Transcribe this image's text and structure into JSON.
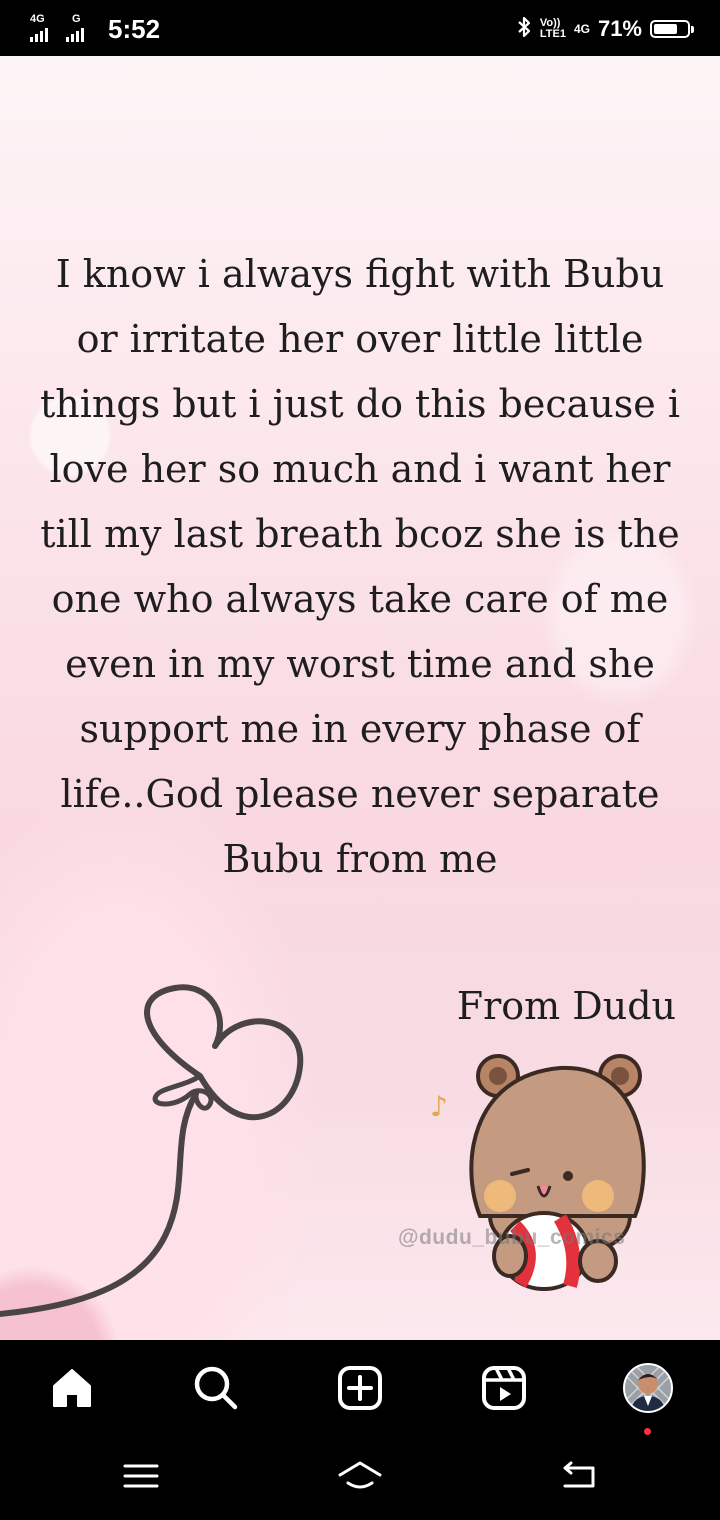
{
  "status_bar": {
    "sim1_network": "4G",
    "sim2_network": "G",
    "time": "5:52",
    "volte_line1": "Vo))",
    "volte_line2": "LTE1",
    "data_network": "4G",
    "battery_percent": "71%",
    "battery_level": 0.71,
    "icons": [
      "signal-icon",
      "signal-icon",
      "bluetooth-icon",
      "battery-icon"
    ]
  },
  "post": {
    "quote": "I know i always fight with Bubu or irritate her over little little things but i just do this because i love her so much and i want her till my last breath bcoz she is the one who always take care of me even in my worst time and she support me in every phase of life..God please never separate Bubu from me",
    "signature": "From Dudu",
    "watermark": "@dudu_bubu_comics"
  },
  "app_nav": {
    "items": [
      {
        "name": "home",
        "icon": "home-icon",
        "active": true
      },
      {
        "name": "search",
        "icon": "search-icon"
      },
      {
        "name": "create",
        "icon": "plus-square-icon"
      },
      {
        "name": "reels",
        "icon": "reels-icon"
      },
      {
        "name": "profile",
        "icon": "avatar",
        "has_notification_dot": true
      }
    ],
    "notification_color": "#ff3040"
  },
  "system_nav": {
    "items": [
      "menu-icon",
      "home-gesture-icon",
      "back-icon"
    ]
  }
}
